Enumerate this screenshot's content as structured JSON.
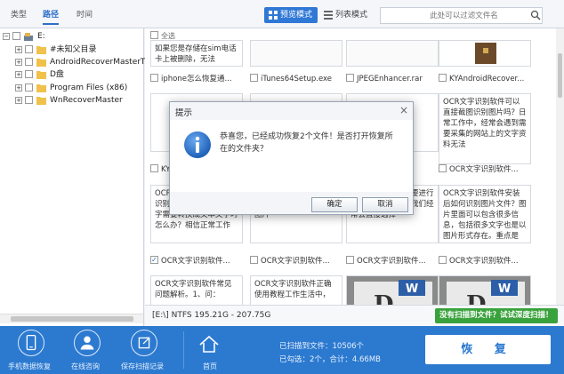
{
  "top": {
    "tabs": [
      "类型",
      "路径",
      "时间"
    ],
    "active_tab": 1,
    "preview_mode": "预览模式",
    "list_mode": "列表模式",
    "search_placeholder": "此处可以过滤文件名"
  },
  "tree": {
    "root": "E:",
    "items": [
      "#未知父目录",
      "AndroidRecoverMasterT",
      "D盘",
      "Program Files (x86)",
      "WnRecoverMaster"
    ]
  },
  "grid": {
    "select_all": "全选",
    "row1_captions": [
      "iphone怎么恢复通...",
      "iTunes64Setup.exe",
      "JPEGEnhancer.rar",
      "KYAndroidRecover..."
    ],
    "row1_top_text": "如果您是存储在sim电话卡上被删除，无法",
    "card_ocr1": "OCR文字识别软件可以直接截图识别图片吗？日常工作中，经常会遇到需要采集的网站上的文字资料无法",
    "row2_captions": [
      "KY",
      "OCR文字识别软件..."
    ],
    "card_ocr2": "OCR文字识别软件如何识别 当你遇到图片的文字需要转换成文本文字时怎么办？相信正常工作",
    "card_ocr3": "任在图片转换的时候，进行图片转换，那么如何将图片",
    "card_ocr4": "在日常工作中，需要进行图片转换的时候，我们经常会直接选择",
    "card_ocr5": "OCR文字识别软件安装后如何识别图片文件？图片里面可以包含很多信息，包括很多文字也是以图片形式存在。重点是",
    "row3_captions": [
      "OCR文字识别软件...",
      "OCR文字识别软件...",
      "OCR文字识别软件...",
      "OCR文字识别软件..."
    ],
    "card_ocr6": "OCR文字识别软件常见问题解析。1、问：",
    "card_ocr7": "OCR文字识别软件正确使用教程工作生活中，",
    "card_ocr3b": "任在图片转换的时候，进行图片转换时，那么如何将图片",
    "checked_index": 0
  },
  "status": {
    "disk_info": "[E:\\] NTFS 195.21G - 207.75G",
    "deep_scan": "没有扫描到文件？试试深度扫描！"
  },
  "bottom": {
    "buttons": [
      "手机数据恢复",
      "在线咨询",
      "保存扫描记录"
    ],
    "home": "首页",
    "found_label": "已扫描到文件：10506个",
    "selected_label": "已勾选：2个，合计：4.66MB",
    "recover": "恢 复"
  },
  "dialog": {
    "title": "提示",
    "message": "恭喜您，已经成功恢复2个文件！是否打开恢复所在的文件夹？",
    "ok": "确定",
    "cancel": "取消"
  },
  "colors": {
    "accent": "#2f78d6",
    "bottom_bar": "#2c7ad0",
    "deep_scan": "#3aa23c"
  }
}
